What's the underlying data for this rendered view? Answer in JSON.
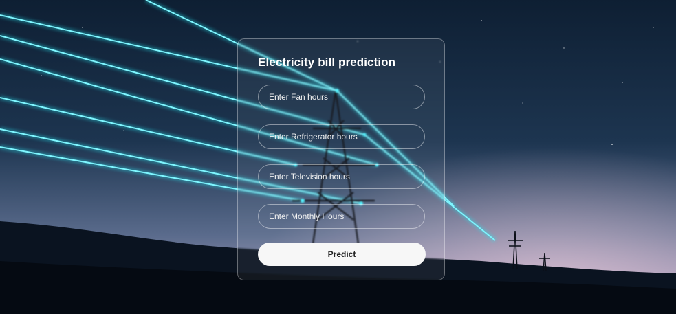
{
  "form": {
    "title": "Electricity bill prediction",
    "fields": [
      {
        "placeholder": "Enter Fan hours"
      },
      {
        "placeholder": "Enter Refrigerator hours"
      },
      {
        "placeholder": "Enter Television hours"
      },
      {
        "placeholder": "Enter Monthly Hours"
      }
    ],
    "submit_label": "Predict"
  },
  "colors": {
    "beam": "#27e2ee",
    "sky_top": "#0f2136",
    "sky_horizon": "#b7a6c4",
    "button_bg": "#f7f7f7"
  }
}
